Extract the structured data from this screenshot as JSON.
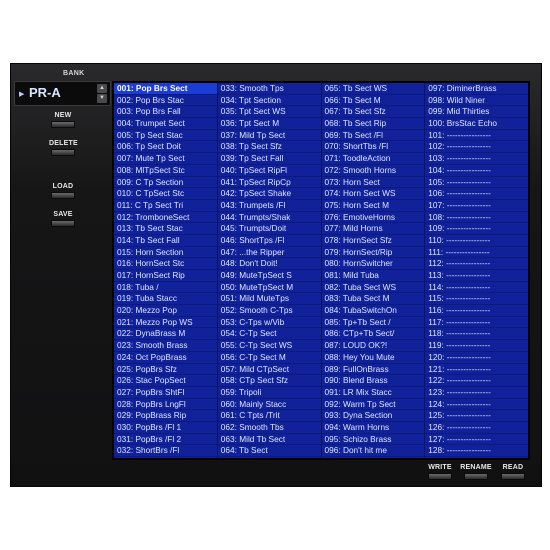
{
  "bank": {
    "label": "BANK",
    "name": "PR-A",
    "arrow_icon": "triangle-right",
    "up_icon": "▲",
    "down_icon": "▼"
  },
  "side_buttons": {
    "new": "NEW",
    "delete": "DELETE",
    "load": "LOAD",
    "save": "SAVE"
  },
  "bottom_buttons": {
    "write": "WRITE",
    "rename": "RENAME",
    "read": "READ"
  },
  "selected_index": 0,
  "patches": [
    "001: Pop Brs Sect",
    "002: Pop Brs Stac",
    "003: Pop Brs Fall",
    "004: Trumpet Sect",
    "005: Tp Sect Stac",
    "006: Tp Sect Doit",
    "007: Mute Tp Sect",
    "008: MlTpSect Stc",
    "009: C Tp Section",
    "010: C TpSect Stc",
    "011: C Tp Sect Tri",
    "012: TromboneSect",
    "013: Tb Sect Stac",
    "014: Tb Sect Fall",
    "015: Horn Section",
    "016: HornSect Stc",
    "017: HornSect Rip",
    "018: Tuba /",
    "019: Tuba Stacc",
    "020: Mezzo Pop",
    "021: Mezzo Pop WS",
    "022: DynaBrass M",
    "023: Smooth Brass",
    "024: Oct PopBrass",
    "025: PopBrs Sfz",
    "026: Stac PopSect",
    "027: PopBrs ShtFl",
    "028: PopBrs LngFl",
    "029: PopBrass Rip",
    "030: PopBrs /Fl 1",
    "031: PopBrs /Fl 2",
    "032: ShortBrs /Fl",
    "033: Smooth Tps",
    "034: Tpt Section",
    "035: Tpt Sect WS",
    "036: Tpt Sect M",
    "037: Mild Tp Sect",
    "038: Tp Sect Sfz",
    "039: Tp Sect Fall",
    "040: TpSect RipFl",
    "041: TpSect RipCp",
    "042: TpSect Shake",
    "043: Trumpets /Fl",
    "044: Trumpts/Shak",
    "045: Trumpts/Doit",
    "046: ShortTps /Fl",
    "047: ...the Ripper",
    "048: Don't Doit!",
    "049: MuteTpSect S",
    "050: MuteTpSect M",
    "051: Mild MuteTps",
    "052: Smooth C-Tps",
    "053: C-Tps w/Vib",
    "054: C-Tp Sect",
    "055: C-Tp Sect WS",
    "056: C-Tp Sect M",
    "057: Mild CTpSect",
    "058: CTp Sect Sfz",
    "059: Tripoli",
    "060: Mainly Stacc",
    "061: C Tpts /Trit",
    "062: Smooth Tbs",
    "063: Mild Tb Sect",
    "064: Tb Sect",
    "065: Tb Sect WS",
    "066: Tb Sect M",
    "067: Tb Sect Sfz",
    "068: Tb Sect Rip",
    "069: Tb Sect /Fl",
    "070: ShortTbs /Fl",
    "071: ToodleAction",
    "072: Smooth Horns",
    "073: Horn Sect",
    "074: Horn Sect WS",
    "075: Horn Sect M",
    "076: EmotiveHorns",
    "077: Mild Horns",
    "078: HornSect Sfz",
    "079: HornSect/Rip",
    "080: HornSwitcher",
    "081: Mild Tuba",
    "082: Tuba Sect WS",
    "083: Tuba Sect M",
    "084: TubaSwitchOn",
    "085: Tp+Tb Sect /",
    "086: CTp+Tb Sect/",
    "087: LOUD OK?!",
    "088: Hey You Mute",
    "089: FullOnBrass",
    "090: Blend Brass",
    "091: LR Mix Stacc",
    "092: Warm Tp Sect",
    "093: Dyna Section",
    "094: Warm Horns",
    "095: Schizo Brass",
    "096: Don't hit me",
    "097: DiminerBrass",
    "098: Wild Niner",
    "099: Mid Thirties",
    "100: BrsStac Echo",
    "101: ----------------",
    "102: ----------------",
    "103: ----------------",
    "104: ----------------",
    "105: ----------------",
    "106: ----------------",
    "107: ----------------",
    "108: ----------------",
    "109: ----------------",
    "110: ----------------",
    "111: ----------------",
    "112: ----------------",
    "113: ----------------",
    "114: ----------------",
    "115: ----------------",
    "116: ----------------",
    "117: ----------------",
    "118: ----------------",
    "119: ----------------",
    "120: ----------------",
    "121: ----------------",
    "122: ----------------",
    "123: ----------------",
    "124: ----------------",
    "125: ----------------",
    "126: ----------------",
    "127: ----------------",
    "128: ----------------"
  ],
  "colors": {
    "list_bg": "#10219a",
    "selected_bg": "#1b3dd6"
  }
}
